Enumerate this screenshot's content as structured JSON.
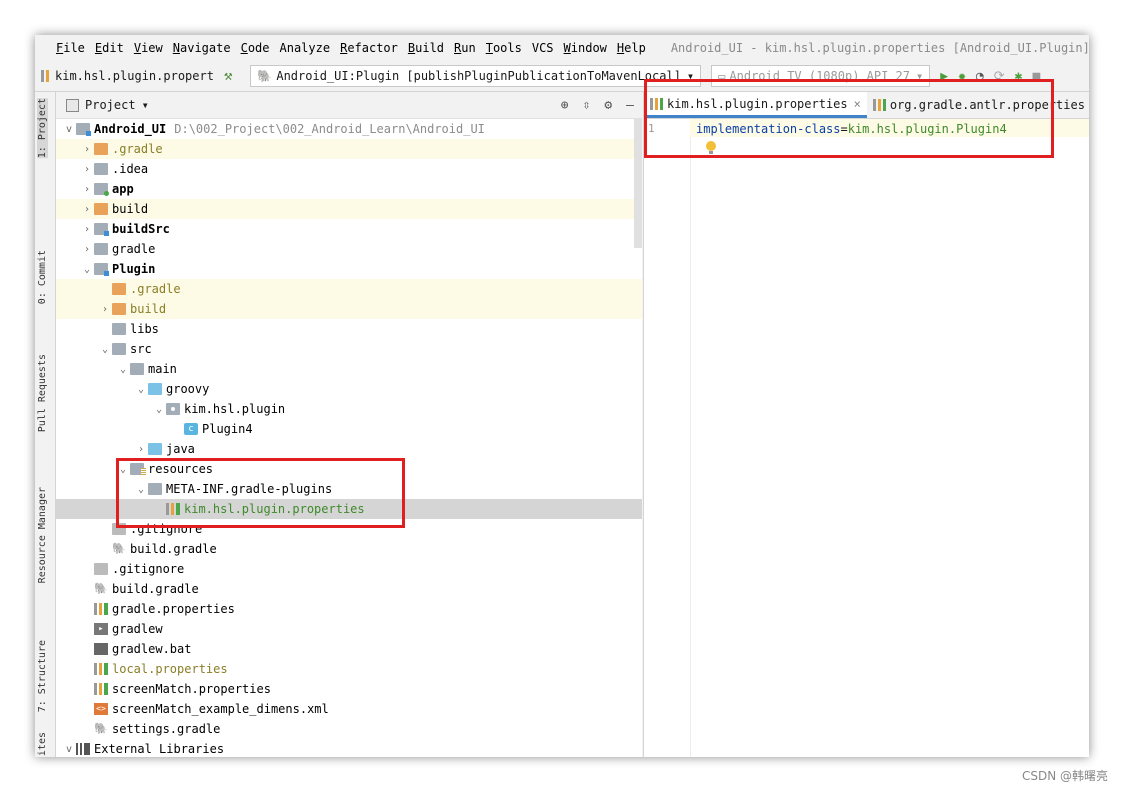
{
  "menu": {
    "items": [
      {
        "u": "F",
        "rest": "ile"
      },
      {
        "u": "E",
        "rest": "dit"
      },
      {
        "u": "V",
        "rest": "iew"
      },
      {
        "u": "N",
        "rest": "avigate"
      },
      {
        "u": "C",
        "rest": "ode"
      },
      {
        "u": "",
        "rest": "Analyze"
      },
      {
        "u": "R",
        "rest": "efactor"
      },
      {
        "u": "B",
        "rest": "uild"
      },
      {
        "u": "R",
        "rest": "un"
      },
      {
        "u": "T",
        "rest": "ools"
      },
      {
        "u": "",
        "rest": "VCS"
      },
      {
        "u": "W",
        "rest": "indow"
      },
      {
        "u": "H",
        "rest": "elp"
      }
    ],
    "window_title": "Android_UI - kim.hsl.plugin.properties [Android_UI.Plugin]"
  },
  "toolbar": {
    "breadcrumb": "kim.hsl.plugin.propert",
    "run_config": "Android_UI:Plugin [publishPluginPublicationToMavenLocal]",
    "device": "Android TV (1080p) API 27"
  },
  "stripe": {
    "project": "1: Project",
    "commit": "0: Commit",
    "pull": "Pull Requests",
    "resource": "Resource Manager",
    "structure": "7: Structure",
    "favorites": "ites"
  },
  "project_panel": {
    "title": "Project",
    "root_name": "Android_UI",
    "root_path": "D:\\002_Project\\002_Android_Learn\\Android_UI",
    "rows": [
      {
        "indent": 1,
        "arrow": ">",
        "icon": "folder orange",
        "label": ".gradle",
        "style": "olive",
        "bg": "yellow"
      },
      {
        "indent": 1,
        "arrow": ">",
        "icon": "folder",
        "label": ".idea",
        "style": "",
        "bg": ""
      },
      {
        "indent": 1,
        "arrow": ">",
        "icon": "folder app",
        "label": "app",
        "style": "bold",
        "bg": ""
      },
      {
        "indent": 1,
        "arrow": ">",
        "icon": "folder orange",
        "label": "build",
        "style": "",
        "bg": "yellow"
      },
      {
        "indent": 1,
        "arrow": ">",
        "icon": "folder module",
        "label": "buildSrc",
        "style": "bold",
        "bg": ""
      },
      {
        "indent": 1,
        "arrow": ">",
        "icon": "folder",
        "label": "gradle",
        "style": "",
        "bg": ""
      },
      {
        "indent": 1,
        "arrow": "v",
        "icon": "folder module",
        "label": "Plugin",
        "style": "bold",
        "bg": ""
      },
      {
        "indent": 2,
        "arrow": "",
        "icon": "folder orange",
        "label": ".gradle",
        "style": "olive",
        "bg": "yellow"
      },
      {
        "indent": 2,
        "arrow": ">",
        "icon": "folder orange",
        "label": "build",
        "style": "olive",
        "bg": "yellow"
      },
      {
        "indent": 2,
        "arrow": "",
        "icon": "folder",
        "label": "libs",
        "style": "",
        "bg": ""
      },
      {
        "indent": 2,
        "arrow": "v",
        "icon": "folder",
        "label": "src",
        "style": "",
        "bg": ""
      },
      {
        "indent": 3,
        "arrow": "v",
        "icon": "folder",
        "label": "main",
        "style": "",
        "bg": ""
      },
      {
        "indent": 4,
        "arrow": "v",
        "icon": "folder blue",
        "label": "groovy",
        "style": "",
        "bg": ""
      },
      {
        "indent": 5,
        "arrow": "v",
        "icon": "folder pkg",
        "label": "kim.hsl.plugin",
        "style": "",
        "bg": ""
      },
      {
        "indent": 6,
        "arrow": "",
        "icon": "cls",
        "label": "Plugin4",
        "style": "",
        "bg": ""
      },
      {
        "indent": 4,
        "arrow": ">",
        "icon": "folder blue",
        "label": "java",
        "style": "",
        "bg": ""
      },
      {
        "indent": 3,
        "arrow": "v",
        "icon": "folder res",
        "label": "resources",
        "style": "",
        "bg": ""
      },
      {
        "indent": 4,
        "arrow": "v",
        "icon": "folder",
        "label": "META-INF.gradle-plugins",
        "style": "",
        "bg": ""
      },
      {
        "indent": 5,
        "arrow": "",
        "icon": "propfile",
        "label": "kim.hsl.plugin.properties",
        "style": "green",
        "bg": "selected"
      },
      {
        "indent": 2,
        "arrow": "",
        "icon": "ignorefile",
        "label": ".gitignore",
        "style": "",
        "bg": ""
      },
      {
        "indent": 2,
        "arrow": "",
        "icon": "gradlefile",
        "label": "build.gradle",
        "style": "",
        "bg": ""
      },
      {
        "indent": 1,
        "arrow": "",
        "icon": "ignorefile",
        "label": ".gitignore",
        "style": "",
        "bg": ""
      },
      {
        "indent": 1,
        "arrow": "",
        "icon": "gradlefile",
        "label": "build.gradle",
        "style": "",
        "bg": ""
      },
      {
        "indent": 1,
        "arrow": "",
        "icon": "propfile",
        "label": "gradle.properties",
        "style": "",
        "bg": ""
      },
      {
        "indent": 1,
        "arrow": "",
        "icon": "shellfile",
        "label": "gradlew",
        "style": "",
        "bg": ""
      },
      {
        "indent": 1,
        "arrow": "",
        "icon": "batfile",
        "label": "gradlew.bat",
        "style": "",
        "bg": ""
      },
      {
        "indent": 1,
        "arrow": "",
        "icon": "propfile",
        "label": "local.properties",
        "style": "olive",
        "bg": ""
      },
      {
        "indent": 1,
        "arrow": "",
        "icon": "propfile",
        "label": "screenMatch.properties",
        "style": "",
        "bg": ""
      },
      {
        "indent": 1,
        "arrow": "",
        "icon": "xmlfile",
        "label": "screenMatch_example_dimens.xml",
        "style": "",
        "bg": ""
      },
      {
        "indent": 1,
        "arrow": "",
        "icon": "gradlefile",
        "label": "settings.gradle",
        "style": "",
        "bg": ""
      }
    ],
    "external_libraries": "External Libraries"
  },
  "editor": {
    "tabs": [
      {
        "label": "kim.hsl.plugin.properties",
        "active": true
      },
      {
        "label": "org.gradle.antlr.properties",
        "active": false
      }
    ],
    "line_number": "1",
    "code_key": "implementation-class",
    "code_eq": "=",
    "code_value": "kim.hsl.plugin.Plugin4"
  },
  "watermark": "CSDN @韩曙亮"
}
